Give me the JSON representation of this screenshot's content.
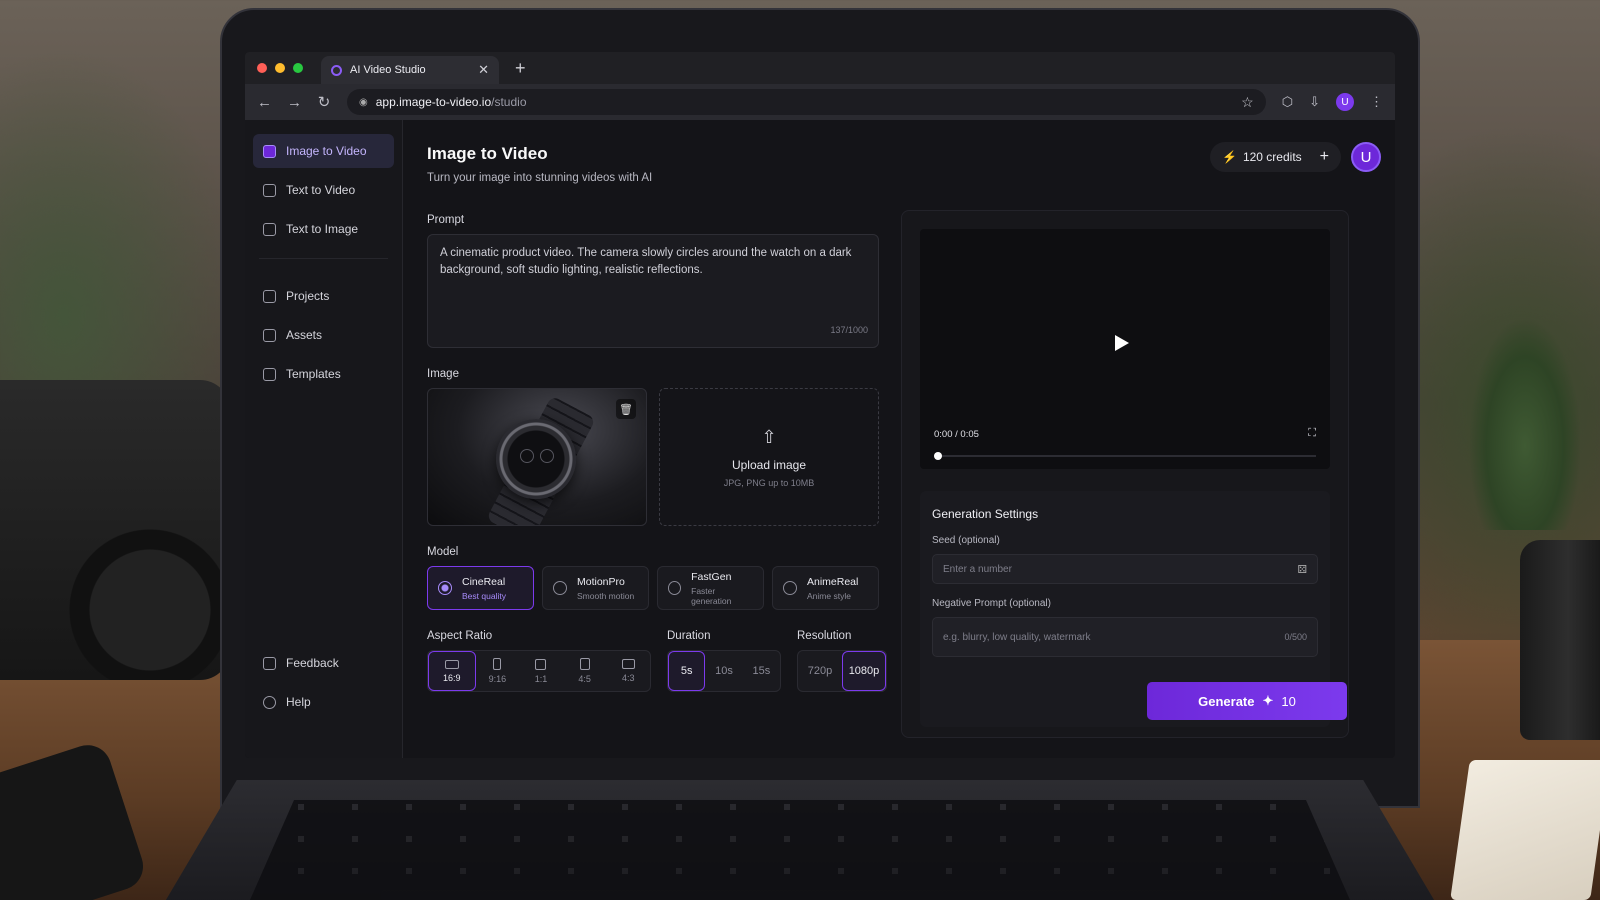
{
  "browser": {
    "tab_title": "AI Video Studio",
    "url_host": "app.image-to-video.io",
    "url_path": "/studio",
    "profile_initial": "U"
  },
  "sidebar": {
    "items": [
      {
        "label": "Image to Video",
        "active": true
      },
      {
        "label": "Text to Video"
      },
      {
        "label": "Text to Image"
      },
      {
        "label": "Projects"
      },
      {
        "label": "Assets"
      },
      {
        "label": "Templates"
      }
    ],
    "bottom": [
      {
        "label": "Feedback"
      },
      {
        "label": "Help"
      }
    ]
  },
  "header": {
    "title": "Image to Video",
    "subtitle": "Turn your image into stunning videos with AI",
    "credits": "120 credits",
    "avatar_initial": "U"
  },
  "prompt": {
    "label": "Prompt",
    "value": "A cinematic product video. The camera slowly circles around the watch on a dark background, soft studio lighting, realistic reflections.",
    "counter": "137/1000"
  },
  "image": {
    "label": "Image",
    "upload_title": "Upload image",
    "upload_hint": "JPG, PNG up to 10MB"
  },
  "model": {
    "label": "Model",
    "options": [
      {
        "name": "CineReal",
        "desc": "Best quality",
        "active": true
      },
      {
        "name": "MotionPro",
        "desc": "Smooth motion"
      },
      {
        "name": "FastGen",
        "desc": "Faster generation"
      },
      {
        "name": "AnimeReal",
        "desc": "Anime style"
      }
    ]
  },
  "aspect_ratio": {
    "label": "Aspect Ratio",
    "options": [
      "16:9",
      "9:16",
      "1:1",
      "4:5",
      "4:3"
    ],
    "selected": "16:9"
  },
  "duration": {
    "label": "Duration",
    "options": [
      "5s",
      "10s",
      "15s"
    ],
    "selected": "5s"
  },
  "resolution": {
    "label": "Resolution",
    "options": [
      "720p",
      "1080p"
    ],
    "selected": "1080p"
  },
  "player": {
    "time": "0:00 / 0:05",
    "progress": 0
  },
  "settings": {
    "title": "Generation Settings",
    "seed_label": "Seed (optional)",
    "seed_placeholder": "Enter a number",
    "neg_label": "Negative Prompt (optional)",
    "neg_placeholder": "e.g. blurry, low quality, watermark",
    "neg_counter": "0/500"
  },
  "generate": {
    "label": "Generate",
    "cost": "10"
  },
  "colors": {
    "accent": "#7c3aed",
    "accent_light": "#a78bfa",
    "credits_bolt": "#f59e0b"
  }
}
